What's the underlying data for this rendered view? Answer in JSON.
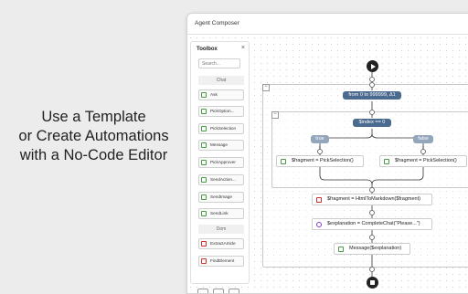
{
  "promo": {
    "line1": "Use a Template",
    "line2": "or Create Automations",
    "line3": "with a No-Code Editor"
  },
  "window": {
    "title": "Agent Composer"
  },
  "toolbox": {
    "title": "Toolbox",
    "close": "×",
    "search_placeholder": "Search...",
    "categories": [
      "Chat",
      "Dom"
    ],
    "items": [
      "Ask",
      "PickOption...",
      "PickSelection",
      "Message",
      "PickApprover",
      "SendAction...",
      "SendImage",
      "SendLink",
      "ExtractArticle",
      "FindElement"
    ]
  },
  "flow": {
    "loop_label": "from 0 to 999999, Δ1",
    "condition": "$index == 0",
    "true_label": "true",
    "false_label": "false",
    "branch_true_node": "$fragment = PickSelection()",
    "branch_false_node": "$fragment = PickSelection()",
    "node_markdown": "$fragment = HtmlToMarkdown($fragment)",
    "node_chat": "$explanation = CompleteChat(\"Please...\")",
    "node_message": "Message($explanation)",
    "collapse_symbol": "−"
  },
  "colors": {
    "pill_dark": "#4b6a8f",
    "pill_gray": "#93a6bb",
    "icon_green": "#4a9a4a",
    "icon_red": "#cc3333",
    "icon_purple": "#7d3cc8"
  }
}
